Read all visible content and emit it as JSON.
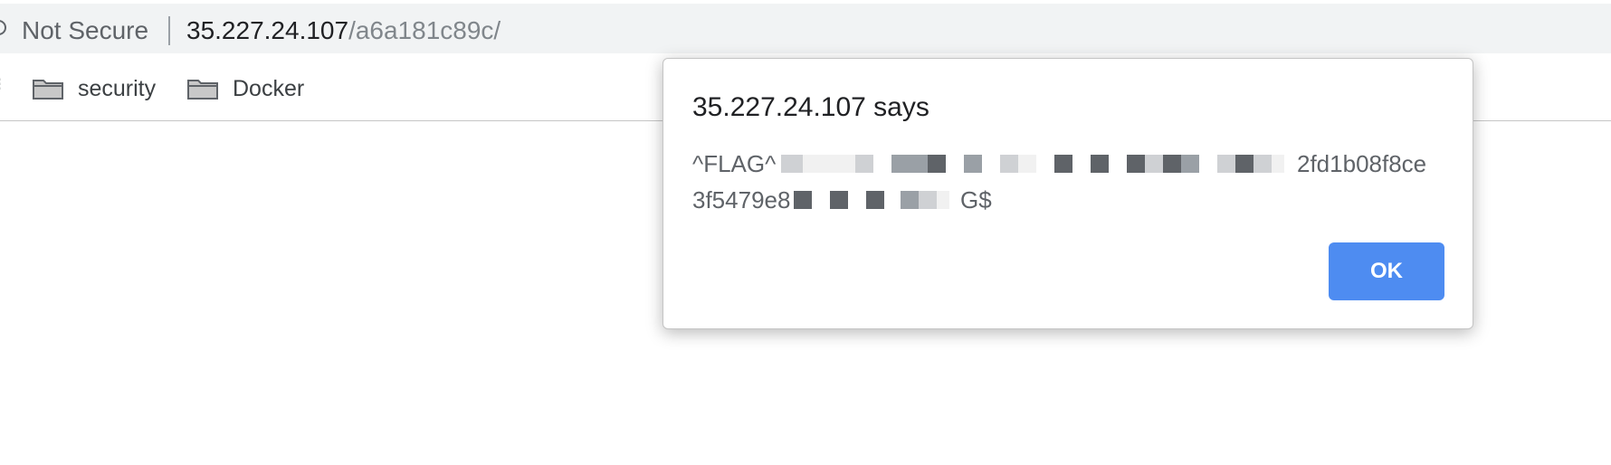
{
  "address_bar": {
    "security_text": "Not Secure",
    "url_host": "35.227.24.107",
    "url_path": "/a6a181c89c/"
  },
  "bookmarks": [
    {
      "label": "security",
      "icon": "folder-icon"
    },
    {
      "label": "Docker",
      "icon": "folder-icon"
    }
  ],
  "dialog": {
    "title": "35.227.24.107 says",
    "message_line1_start": "^FLAG^",
    "message_line1_end": "2fd1b08f8ce",
    "message_line2_start": "3f5479e8",
    "message_line2_end": "G$",
    "ok_label": "OK"
  },
  "colors": {
    "button_blue": "#4e8cf1",
    "toolbar_bg": "#f1f3f4",
    "redaction_dark": "#5f6368",
    "redaction_mid": "#9aa0a6",
    "redaction_light": "#cfd1d4"
  }
}
